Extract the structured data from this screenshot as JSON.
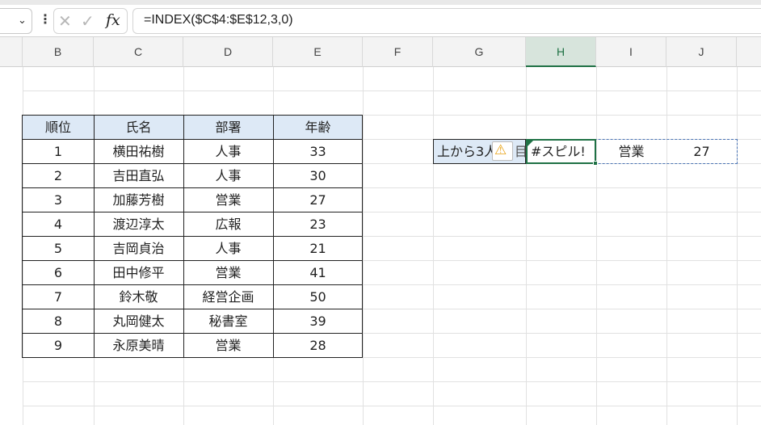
{
  "formula_bar": {
    "chevron": "⌄",
    "dots": "⋮",
    "cancel": "✕",
    "enter": "✓",
    "fx": "fx",
    "formula": "=INDEX($C$4:$E$12,3,0)"
  },
  "columns": [
    "B",
    "C",
    "D",
    "E",
    "F",
    "G",
    "H",
    "I",
    "J"
  ],
  "active_column": "H",
  "table": {
    "headers": [
      "順位",
      "氏名",
      "部署",
      "年齢"
    ],
    "rows": [
      [
        "1",
        "横田祐樹",
        "人事",
        "33"
      ],
      [
        "2",
        "吉田直弘",
        "人事",
        "30"
      ],
      [
        "3",
        "加藤芳樹",
        "営業",
        "27"
      ],
      [
        "4",
        "渡辺淳太",
        "広報",
        "23"
      ],
      [
        "5",
        "吉岡貞治",
        "人事",
        "21"
      ],
      [
        "6",
        "田中修平",
        "営業",
        "41"
      ],
      [
        "7",
        "鈴木敬",
        "経営企画",
        "50"
      ],
      [
        "8",
        "丸岡健太",
        "秘書室",
        "39"
      ],
      [
        "9",
        "永原美晴",
        "営業",
        "28"
      ]
    ]
  },
  "g5": {
    "label": "上から3人目",
    "trail": "目"
  },
  "warning_icon": "warning-icon",
  "warning_glyph": "⚠",
  "h5": {
    "value": "#スピル!"
  },
  "i5": {
    "value": "営業"
  },
  "j5": {
    "value": "27"
  },
  "colors": {
    "accent_green": "#1f7145",
    "header_fill": "#dde9f6",
    "spill_border": "#4a74b5",
    "warning": "#e8a317"
  }
}
